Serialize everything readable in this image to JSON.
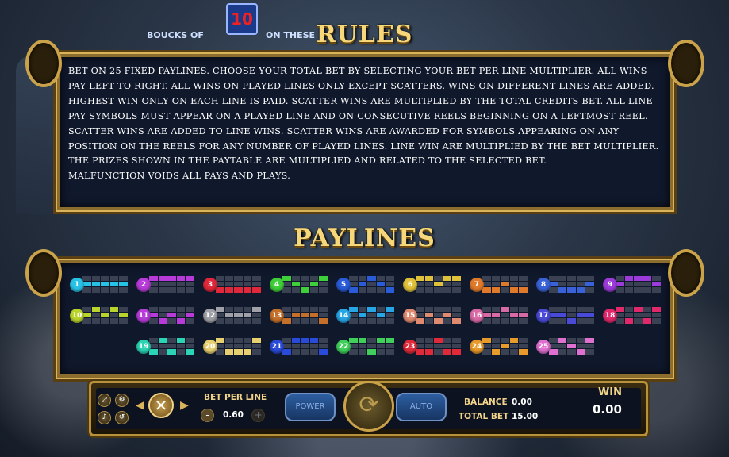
{
  "top_banner": {
    "left_text": "BOUCKS OF",
    "badge": "10",
    "right_text": "ON THESE"
  },
  "rules": {
    "title": "RULES",
    "lines": [
      "Bet on 25 fixed paylines. Choose your total bet by selecting your bet per line multiplier. All wins",
      "pay left to right. All wins on played lines only except scatters. Wins on different lines are added.",
      "Highest win only on each line is paid. Scatter wins are multiplied by the total credits bet. All line",
      "pay symbols must appear on a played line and on consecutive reels beginning on a leftmost reel.",
      "Scatter wins are added to line wins. Scatter wins are awarded for symbols appearing on any",
      "position on the reels for any number of played lines. Line win are multiplied by the bet multiplier.",
      "The prizes shown in the paytable are multiplied and related to the selected bet.",
      "Malfunction voids all pays and plays."
    ]
  },
  "paylines": {
    "title": "PAYLINES",
    "items": [
      {
        "num": "1",
        "color": "#27c3e6",
        "rows": [
          1,
          1,
          1,
          1,
          1
        ]
      },
      {
        "num": "2",
        "color": "#b83bd9",
        "rows": [
          0,
          0,
          0,
          0,
          0
        ]
      },
      {
        "num": "3",
        "color": "#e0283a",
        "rows": [
          2,
          2,
          2,
          2,
          2
        ]
      },
      {
        "num": "4",
        "color": "#3fcf3a",
        "rows": [
          0,
          1,
          2,
          1,
          0
        ]
      },
      {
        "num": "5",
        "color": "#2a5bd8",
        "rows": [
          2,
          1,
          0,
          1,
          2
        ]
      },
      {
        "num": "6",
        "color": "#e0c23a",
        "rows": [
          0,
          0,
          1,
          0,
          0
        ]
      },
      {
        "num": "7",
        "color": "#e07a2a",
        "rows": [
          2,
          2,
          1,
          2,
          2
        ]
      },
      {
        "num": "8",
        "color": "#3a62d8",
        "rows": [
          1,
          2,
          2,
          2,
          1
        ]
      },
      {
        "num": "9",
        "color": "#9c3bd9",
        "rows": [
          1,
          0,
          0,
          0,
          1
        ]
      },
      {
        "num": "10",
        "color": "#b9d42a",
        "rows": [
          1,
          0,
          1,
          0,
          1
        ]
      },
      {
        "num": "11",
        "color": "#b83bd9",
        "rows": [
          1,
          2,
          1,
          2,
          1
        ]
      },
      {
        "num": "12",
        "color": "#a0a0a8",
        "rows": [
          0,
          1,
          1,
          1,
          0
        ]
      },
      {
        "num": "13",
        "color": "#c4702a",
        "rows": [
          2,
          1,
          1,
          1,
          2
        ]
      },
      {
        "num": "14",
        "color": "#27a6e6",
        "rows": [
          0,
          1,
          0,
          1,
          0
        ]
      },
      {
        "num": "15",
        "color": "#e08a70",
        "rows": [
          2,
          1,
          2,
          1,
          2
        ]
      },
      {
        "num": "16",
        "color": "#d96aa6",
        "rows": [
          1,
          1,
          0,
          1,
          1
        ]
      },
      {
        "num": "17",
        "color": "#4a4ad8",
        "rows": [
          1,
          1,
          2,
          1,
          1
        ]
      },
      {
        "num": "18",
        "color": "#e0286a",
        "rows": [
          0,
          2,
          0,
          2,
          0
        ]
      },
      {
        "num": "19",
        "color": "#2ad4b4",
        "rows": [
          2,
          0,
          2,
          0,
          2
        ]
      },
      {
        "num": "20",
        "color": "#e8d070",
        "rows": [
          0,
          2,
          2,
          2,
          0
        ]
      },
      {
        "num": "21",
        "color": "#2a4ad8",
        "rows": [
          2,
          0,
          0,
          0,
          2
        ]
      },
      {
        "num": "22",
        "color": "#3fcf5a",
        "rows": [
          0,
          0,
          2,
          0,
          0
        ]
      },
      {
        "num": "23",
        "color": "#e02a3a",
        "rows": [
          2,
          2,
          0,
          2,
          2
        ]
      },
      {
        "num": "24",
        "color": "#e89a2a",
        "rows": [
          0,
          2,
          1,
          0,
          2
        ]
      },
      {
        "num": "25",
        "color": "#e070d0",
        "rows": [
          2,
          0,
          1,
          2,
          0
        ]
      }
    ]
  },
  "controls": {
    "bet_per_line_label": "BET PER LINE",
    "bet_per_line_value": "0.60",
    "minus": "-",
    "plus": "+",
    "power_label": "POWER",
    "auto_label": "AUTO",
    "balance_label": "BALANCE",
    "balance_value": "0.00",
    "total_bet_label": "TOTAL BET",
    "total_bet_value": "15.00",
    "win_label": "WIN",
    "win_value": "0.00",
    "close_glyph": "✕",
    "spin_glyph": "⟳",
    "prev_glyph": "◀",
    "next_glyph": "▶"
  },
  "icons": [
    "fullscreen-icon",
    "settings-icon",
    "sound-icon",
    "history-icon"
  ]
}
